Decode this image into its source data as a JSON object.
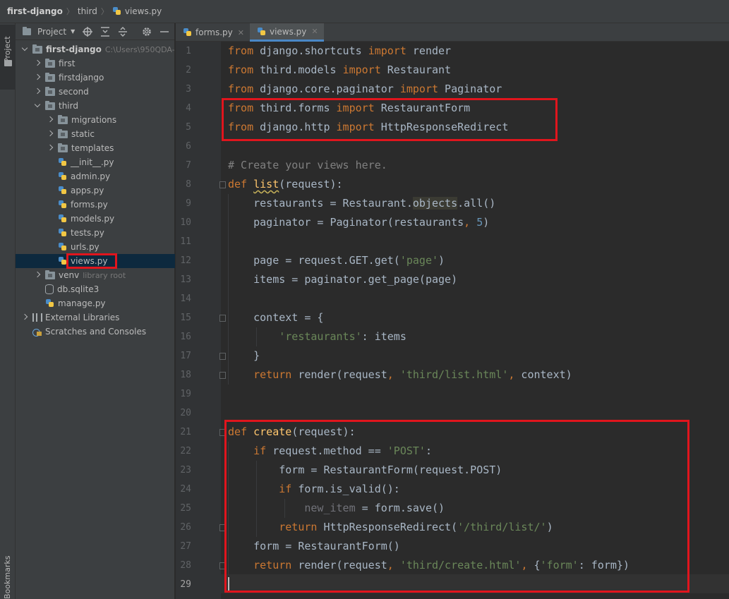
{
  "breadcrumb": {
    "project": "first-django",
    "folder": "third",
    "file": "views.py"
  },
  "stripe": {
    "project_label": "Project",
    "bookmarks_label": "Bookmarks"
  },
  "project_panel": {
    "title": "Project",
    "tree": [
      {
        "label": "first-django",
        "hint": "C:\\Users\\950QDA-",
        "type": "folder",
        "level": 0,
        "arrow": "down",
        "bold": true
      },
      {
        "label": "first",
        "type": "folder",
        "level": 1,
        "arrow": "right"
      },
      {
        "label": "firstdjango",
        "type": "folder",
        "level": 1,
        "arrow": "right"
      },
      {
        "label": "second",
        "type": "folder",
        "level": 1,
        "arrow": "right"
      },
      {
        "label": "third",
        "type": "folder",
        "level": 1,
        "arrow": "down"
      },
      {
        "label": "migrations",
        "type": "folder",
        "level": 2,
        "arrow": "right"
      },
      {
        "label": "static",
        "type": "folder",
        "level": 2,
        "arrow": "right"
      },
      {
        "label": "templates",
        "type": "folder",
        "level": 2,
        "arrow": "right"
      },
      {
        "label": "__init__.py",
        "type": "py",
        "level": 2
      },
      {
        "label": "admin.py",
        "type": "py",
        "level": 2
      },
      {
        "label": "apps.py",
        "type": "py",
        "level": 2
      },
      {
        "label": "forms.py",
        "type": "py",
        "level": 2
      },
      {
        "label": "models.py",
        "type": "py",
        "level": 2
      },
      {
        "label": "tests.py",
        "type": "py",
        "level": 2
      },
      {
        "label": "urls.py",
        "type": "py",
        "level": 2
      },
      {
        "label": "views.py",
        "type": "py",
        "level": 2,
        "selected": true
      },
      {
        "label": "venv",
        "hint": "library root",
        "type": "folder",
        "level": 1,
        "arrow": "right"
      },
      {
        "label": "db.sqlite3",
        "type": "db",
        "level": 1
      },
      {
        "label": "manage.py",
        "type": "py",
        "level": 1
      },
      {
        "label": "External Libraries",
        "type": "lib",
        "level": 0,
        "arrow": "right"
      },
      {
        "label": "Scratches and Consoles",
        "type": "scratch",
        "level": 0
      }
    ]
  },
  "tabs": [
    {
      "label": "forms.py",
      "active": false
    },
    {
      "label": "views.py",
      "active": true
    }
  ],
  "editor": {
    "current_line": 29,
    "lines": [
      [
        [
          "kw",
          "from"
        ],
        [
          "t",
          " django.shortcuts "
        ],
        [
          "kw",
          "import"
        ],
        [
          "t",
          " render"
        ]
      ],
      [
        [
          "kw",
          "from"
        ],
        [
          "t",
          " third.models "
        ],
        [
          "kw",
          "import"
        ],
        [
          "t",
          " Restaurant"
        ]
      ],
      [
        [
          "kw",
          "from"
        ],
        [
          "t",
          " django.core.paginator "
        ],
        [
          "kw",
          "import"
        ],
        [
          "t",
          " Paginator"
        ]
      ],
      [
        [
          "kw",
          "from"
        ],
        [
          "t",
          " third.forms "
        ],
        [
          "kw",
          "import"
        ],
        [
          "t",
          " RestaurantForm"
        ]
      ],
      [
        [
          "kw",
          "from"
        ],
        [
          "t",
          " django.http "
        ],
        [
          "kw",
          "import"
        ],
        [
          "t",
          " HttpResponseRedirect"
        ]
      ],
      [],
      [
        [
          "cm",
          "# Create your views here."
        ]
      ],
      [
        [
          "kw",
          "def"
        ],
        [
          "t",
          " "
        ],
        [
          "fn",
          "list"
        ],
        [
          "t",
          "(request):"
        ]
      ],
      [
        [
          "t",
          "    restaurants = Restaurant."
        ],
        [
          "hl",
          "objects"
        ],
        [
          "t",
          ".all()"
        ]
      ],
      [
        [
          "t",
          "    paginator = Paginator(restaurants"
        ],
        [
          "kw",
          ","
        ],
        [
          "t",
          " "
        ],
        [
          "num",
          "5"
        ],
        [
          "t",
          ")"
        ]
      ],
      [],
      [
        [
          "t",
          "    page = request.GET.get("
        ],
        [
          "str",
          "'page'"
        ],
        [
          "t",
          ")"
        ]
      ],
      [
        [
          "t",
          "    items = paginator.get_page(page)"
        ]
      ],
      [],
      [
        [
          "t",
          "    context = {"
        ]
      ],
      [
        [
          "t",
          "        "
        ],
        [
          "str",
          "'restaurants'"
        ],
        [
          "t",
          ": items"
        ]
      ],
      [
        [
          "t",
          "    }"
        ]
      ],
      [
        [
          "t",
          "    "
        ],
        [
          "kw",
          "return"
        ],
        [
          "t",
          " render(request"
        ],
        [
          "kw",
          ","
        ],
        [
          "t",
          " "
        ],
        [
          "str",
          "'third/list.html'"
        ],
        [
          "kw",
          ","
        ],
        [
          "t",
          " context)"
        ]
      ],
      [],
      [],
      [
        [
          "kw",
          "def"
        ],
        [
          "t",
          " "
        ],
        [
          "fn",
          "create"
        ],
        [
          "t",
          "(request):"
        ]
      ],
      [
        [
          "t",
          "    "
        ],
        [
          "kw",
          "if"
        ],
        [
          "t",
          " request.method == "
        ],
        [
          "str",
          "'POST'"
        ],
        [
          "t",
          ":"
        ]
      ],
      [
        [
          "t",
          "        form = RestaurantForm(request.POST)"
        ]
      ],
      [
        [
          "t",
          "        "
        ],
        [
          "kw",
          "if"
        ],
        [
          "t",
          " form.is_valid():"
        ]
      ],
      [
        [
          "t",
          "            "
        ],
        [
          "gray",
          "new_item"
        ],
        [
          "t",
          " = form.save()"
        ]
      ],
      [
        [
          "t",
          "        "
        ],
        [
          "kw",
          "return"
        ],
        [
          "t",
          " HttpResponseRedirect("
        ],
        [
          "str",
          "'/third/list/'"
        ],
        [
          "t",
          ")"
        ]
      ],
      [
        [
          "t",
          "    form = RestaurantForm()"
        ]
      ],
      [
        [
          "t",
          "    "
        ],
        [
          "kw",
          "return"
        ],
        [
          "t",
          " render(request"
        ],
        [
          "kw",
          ","
        ],
        [
          "t",
          " "
        ],
        [
          "str",
          "'third/create.html'"
        ],
        [
          "kw",
          ","
        ],
        [
          "t",
          " {"
        ],
        [
          "str",
          "'form'"
        ],
        [
          "t",
          ": form})"
        ]
      ],
      []
    ]
  }
}
